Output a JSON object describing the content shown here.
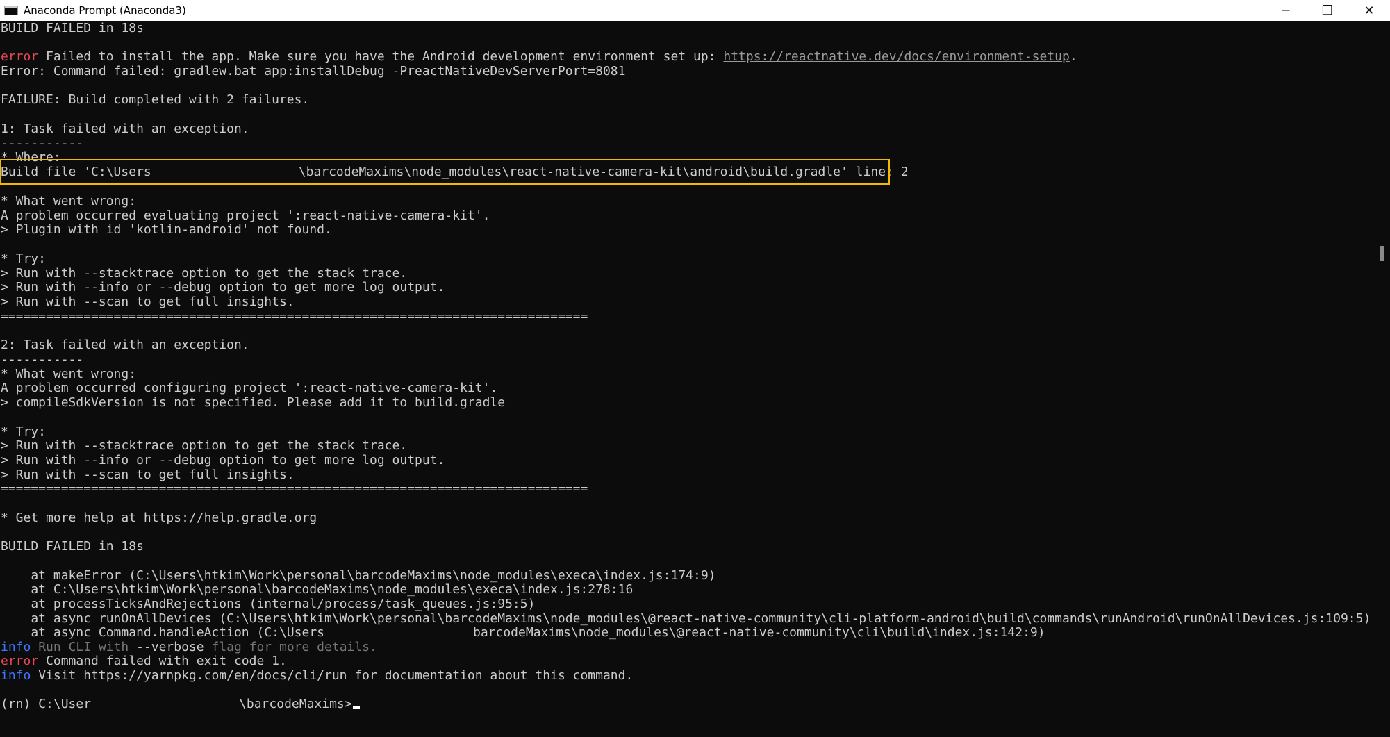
{
  "window": {
    "title": "Anaconda Prompt (Anaconda3)",
    "minimize_glyph": "─",
    "restore_glyph": "❐",
    "close_glyph": "✕"
  },
  "colors": {
    "background": "#0c0c0c",
    "text": "#cccccc",
    "error": "#e74856",
    "info": "#3b78ff",
    "highlight_border": "#f5b800"
  },
  "console": {
    "l01": "BUILD FAILED in 18s",
    "l03_tag": "error",
    "l03_text": " Failed to install the app. Make sure you have the Android development environment set up: ",
    "l03_link": "https://reactnative.dev/docs/environment-setup",
    "l03_end": ".",
    "l04": "Error: Command failed: gradlew.bat app:installDebug -PreactNativeDevServerPort=8081",
    "l06": "FAILURE: Build completed with 2 failures.",
    "l08": "1: Task failed with an exception.",
    "l09": "-----------",
    "l11": "* Where:",
    "l12_start": "Build file 'C:\\Users",
    "l12_end": "\\barcodeMaxims\\node_modules\\react-native-camera-kit\\android\\build.gradle' line: 2",
    "l14": "* What went wrong:",
    "l15": "A problem occurred evaluating project ':react-native-camera-kit'.",
    "l16": "> Plugin with id 'kotlin-android' not found.",
    "l18": "* Try:",
    "l19": "> Run with --stacktrace option to get the stack trace.",
    "l20": "> Run with --info or --debug option to get more log output.",
    "l21": "> Run with --scan to get full insights.",
    "l22": "==============================================================================",
    "l24": "2: Task failed with an exception.",
    "l25": "-----------",
    "l26": "* What went wrong:",
    "l27": "A problem occurred configuring project ':react-native-camera-kit'.",
    "l28": "> compileSdkVersion is not specified. Please add it to build.gradle",
    "l30": "* Try:",
    "l31": "> Run with --stacktrace option to get the stack trace.",
    "l32": "> Run with --info or --debug option to get more log output.",
    "l33": "> Run with --scan to get full insights.",
    "l34": "==============================================================================",
    "l36": "* Get more help at https://help.gradle.org",
    "l38": "BUILD FAILED in 18s",
    "l40": "    at makeError (C:\\Users\\htkim\\Work\\personal\\barcodeMaxims\\node_modules\\execa\\index.js:174:9)",
    "l41": "    at C:\\Users\\htkim\\Work\\personal\\barcodeMaxims\\node_modules\\execa\\index.js:278:16",
    "l42": "    at processTicksAndRejections (internal/process/task_queues.js:95:5)",
    "l43": "    at async runOnAllDevices (C:\\Users\\htkim\\Work\\personal\\barcodeMaxims\\node_modules\\@react-native-community\\cli-platform-android\\build\\commands\\runAndroid\\runOnAllDevices.js:109:5)",
    "l44_start": "    at async Command.handleAction (C:\\Users",
    "l44_end": "barcodeMaxims\\node_modules\\@react-native-community\\cli\\build\\index.js:142:9)",
    "l45_tag": "info",
    "l45_text": " Run CLI with ",
    "l45_flag": "--verbose",
    "l45_end": " flag for more details.",
    "l46_tag": "error",
    "l46_text": " Command failed with exit code 1.",
    "l47_tag": "info",
    "l47_text": " Visit https://yarnpkg.com/en/docs/cli/run for documentation about this command.",
    "prompt_start": "(rn) C:\\User",
    "prompt_end": "\\barcodeMaxims>"
  }
}
